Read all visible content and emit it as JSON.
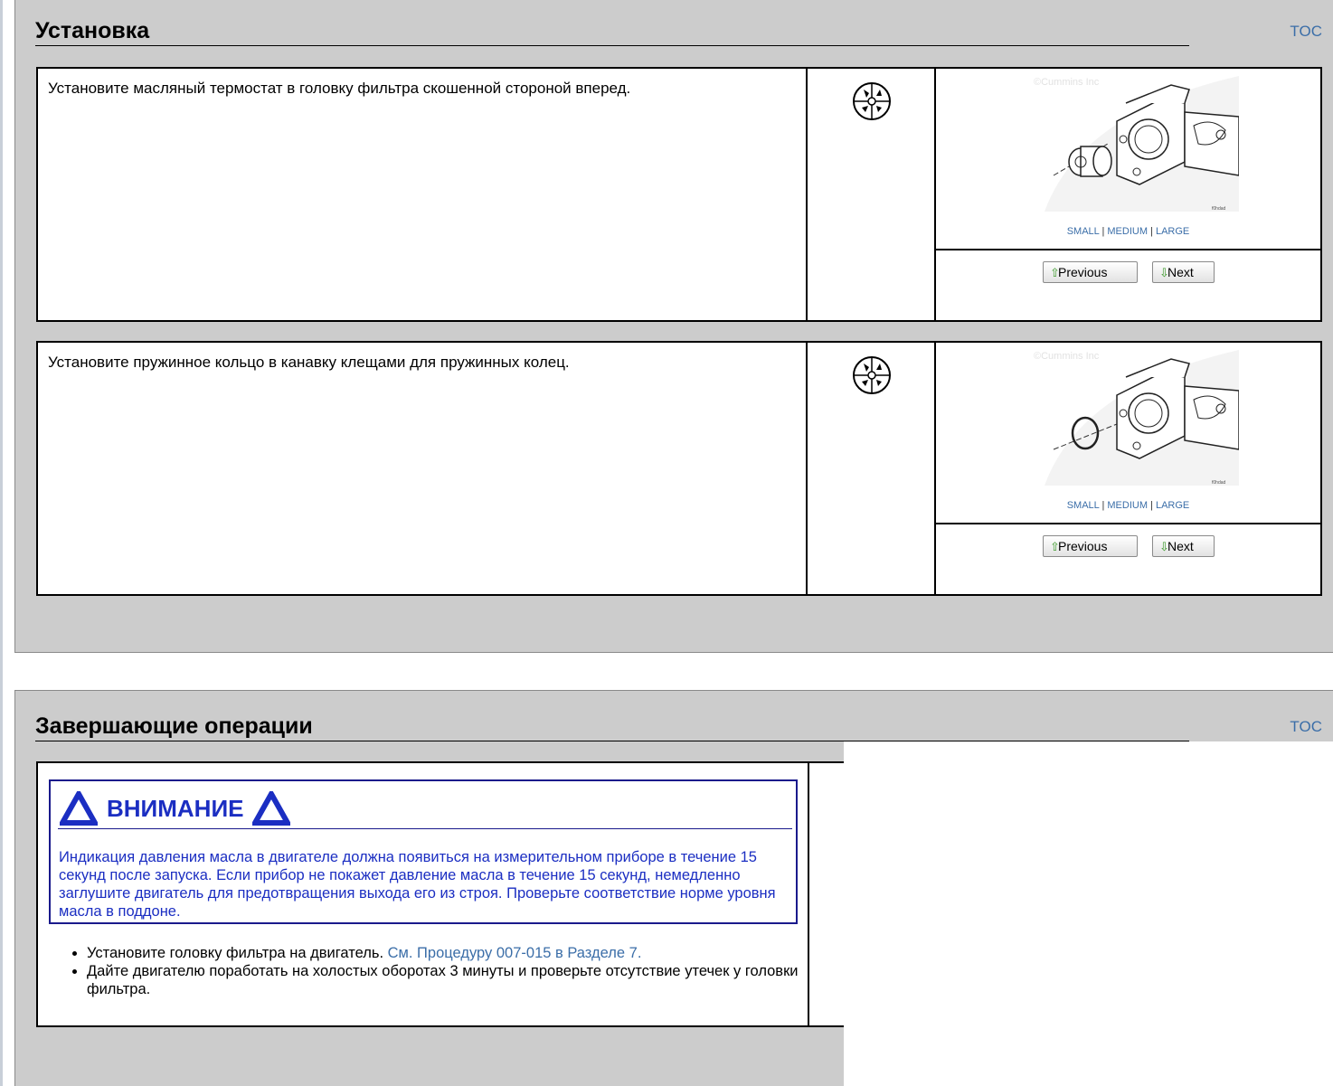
{
  "sections": [
    {
      "title": "Установка",
      "toc": "TOC",
      "steps": [
        {
          "text": "Установите масляный термостат в головку фильтра скошенной стороной вперед.",
          "figure": {
            "copyright": "©Cummins Inc",
            "code": "f0hdad",
            "sizes": [
              "SMALL",
              "MEDIUM",
              "LARGE"
            ],
            "separator": "|"
          },
          "buttons": {
            "previous": "Previous",
            "next": "Next"
          }
        },
        {
          "text": "Установите пружинное кольцо в канавку клещами для пружинных колец.",
          "figure": {
            "copyright": "©Cummins Inc",
            "code": "f0hdad",
            "sizes": [
              "SMALL",
              "MEDIUM",
              "LARGE"
            ],
            "separator": "|"
          },
          "buttons": {
            "previous": "Previous",
            "next": "Next"
          }
        }
      ]
    },
    {
      "title": "Завершающие операции",
      "toc": "TOC",
      "caution": {
        "title": "ВНИМАНИЕ",
        "text": "Индикация давления масла в двигателе должна появиться на измерительном приборе в течение 15 секунд после запуска. Если прибор не покажет давление масла в течение 15 секунд, немедленно заглушите двигатель для предотвращения выхода его из строя. Проверьте соответствие норме уровня масла в поддоне."
      },
      "bullets": [
        {
          "text": "Установите головку фильтра на двигатель. ",
          "link": "См. Процедуру 007-015 в Разделе 7."
        },
        {
          "text": "Дайте двигателю поработать на холостых оборотах 3 минуты и проверьте отсутствие утечек у головки фильтра.",
          "link": ""
        }
      ]
    }
  ],
  "colors": {
    "section_bg": "#cccccc",
    "link": "#3b6ea8",
    "caution_blue": "#1b2ec2",
    "caution_border": "#1a1a8c"
  },
  "icons": {
    "step_icon": "tools-icon",
    "caution_icon": "warning-triangle-icon",
    "previous_icon": "arrow-up-icon",
    "next_icon": "arrow-down-icon"
  }
}
